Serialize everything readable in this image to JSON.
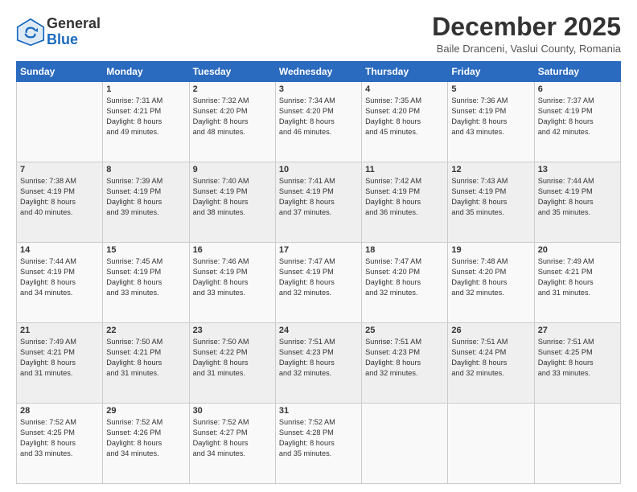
{
  "logo": {
    "general": "General",
    "blue": "Blue"
  },
  "header": {
    "month": "December 2025",
    "location": "Baile Dranceni, Vaslui County, Romania"
  },
  "days": [
    "Sunday",
    "Monday",
    "Tuesday",
    "Wednesday",
    "Thursday",
    "Friday",
    "Saturday"
  ],
  "weeks": [
    [
      {
        "day": "",
        "lines": []
      },
      {
        "day": "1",
        "lines": [
          "Sunrise: 7:31 AM",
          "Sunset: 4:21 PM",
          "Daylight: 8 hours",
          "and 49 minutes."
        ]
      },
      {
        "day": "2",
        "lines": [
          "Sunrise: 7:32 AM",
          "Sunset: 4:20 PM",
          "Daylight: 8 hours",
          "and 48 minutes."
        ]
      },
      {
        "day": "3",
        "lines": [
          "Sunrise: 7:34 AM",
          "Sunset: 4:20 PM",
          "Daylight: 8 hours",
          "and 46 minutes."
        ]
      },
      {
        "day": "4",
        "lines": [
          "Sunrise: 7:35 AM",
          "Sunset: 4:20 PM",
          "Daylight: 8 hours",
          "and 45 minutes."
        ]
      },
      {
        "day": "5",
        "lines": [
          "Sunrise: 7:36 AM",
          "Sunset: 4:19 PM",
          "Daylight: 8 hours",
          "and 43 minutes."
        ]
      },
      {
        "day": "6",
        "lines": [
          "Sunrise: 7:37 AM",
          "Sunset: 4:19 PM",
          "Daylight: 8 hours",
          "and 42 minutes."
        ]
      }
    ],
    [
      {
        "day": "7",
        "lines": [
          "Sunrise: 7:38 AM",
          "Sunset: 4:19 PM",
          "Daylight: 8 hours",
          "and 40 minutes."
        ]
      },
      {
        "day": "8",
        "lines": [
          "Sunrise: 7:39 AM",
          "Sunset: 4:19 PM",
          "Daylight: 8 hours",
          "and 39 minutes."
        ]
      },
      {
        "day": "9",
        "lines": [
          "Sunrise: 7:40 AM",
          "Sunset: 4:19 PM",
          "Daylight: 8 hours",
          "and 38 minutes."
        ]
      },
      {
        "day": "10",
        "lines": [
          "Sunrise: 7:41 AM",
          "Sunset: 4:19 PM",
          "Daylight: 8 hours",
          "and 37 minutes."
        ]
      },
      {
        "day": "11",
        "lines": [
          "Sunrise: 7:42 AM",
          "Sunset: 4:19 PM",
          "Daylight: 8 hours",
          "and 36 minutes."
        ]
      },
      {
        "day": "12",
        "lines": [
          "Sunrise: 7:43 AM",
          "Sunset: 4:19 PM",
          "Daylight: 8 hours",
          "and 35 minutes."
        ]
      },
      {
        "day": "13",
        "lines": [
          "Sunrise: 7:44 AM",
          "Sunset: 4:19 PM",
          "Daylight: 8 hours",
          "and 35 minutes."
        ]
      }
    ],
    [
      {
        "day": "14",
        "lines": [
          "Sunrise: 7:44 AM",
          "Sunset: 4:19 PM",
          "Daylight: 8 hours",
          "and 34 minutes."
        ]
      },
      {
        "day": "15",
        "lines": [
          "Sunrise: 7:45 AM",
          "Sunset: 4:19 PM",
          "Daylight: 8 hours",
          "and 33 minutes."
        ]
      },
      {
        "day": "16",
        "lines": [
          "Sunrise: 7:46 AM",
          "Sunset: 4:19 PM",
          "Daylight: 8 hours",
          "and 33 minutes."
        ]
      },
      {
        "day": "17",
        "lines": [
          "Sunrise: 7:47 AM",
          "Sunset: 4:19 PM",
          "Daylight: 8 hours",
          "and 32 minutes."
        ]
      },
      {
        "day": "18",
        "lines": [
          "Sunrise: 7:47 AM",
          "Sunset: 4:20 PM",
          "Daylight: 8 hours",
          "and 32 minutes."
        ]
      },
      {
        "day": "19",
        "lines": [
          "Sunrise: 7:48 AM",
          "Sunset: 4:20 PM",
          "Daylight: 8 hours",
          "and 32 minutes."
        ]
      },
      {
        "day": "20",
        "lines": [
          "Sunrise: 7:49 AM",
          "Sunset: 4:21 PM",
          "Daylight: 8 hours",
          "and 31 minutes."
        ]
      }
    ],
    [
      {
        "day": "21",
        "lines": [
          "Sunrise: 7:49 AM",
          "Sunset: 4:21 PM",
          "Daylight: 8 hours",
          "and 31 minutes."
        ]
      },
      {
        "day": "22",
        "lines": [
          "Sunrise: 7:50 AM",
          "Sunset: 4:21 PM",
          "Daylight: 8 hours",
          "and 31 minutes."
        ]
      },
      {
        "day": "23",
        "lines": [
          "Sunrise: 7:50 AM",
          "Sunset: 4:22 PM",
          "Daylight: 8 hours",
          "and 31 minutes."
        ]
      },
      {
        "day": "24",
        "lines": [
          "Sunrise: 7:51 AM",
          "Sunset: 4:23 PM",
          "Daylight: 8 hours",
          "and 32 minutes."
        ]
      },
      {
        "day": "25",
        "lines": [
          "Sunrise: 7:51 AM",
          "Sunset: 4:23 PM",
          "Daylight: 8 hours",
          "and 32 minutes."
        ]
      },
      {
        "day": "26",
        "lines": [
          "Sunrise: 7:51 AM",
          "Sunset: 4:24 PM",
          "Daylight: 8 hours",
          "and 32 minutes."
        ]
      },
      {
        "day": "27",
        "lines": [
          "Sunrise: 7:51 AM",
          "Sunset: 4:25 PM",
          "Daylight: 8 hours",
          "and 33 minutes."
        ]
      }
    ],
    [
      {
        "day": "28",
        "lines": [
          "Sunrise: 7:52 AM",
          "Sunset: 4:25 PM",
          "Daylight: 8 hours",
          "and 33 minutes."
        ]
      },
      {
        "day": "29",
        "lines": [
          "Sunrise: 7:52 AM",
          "Sunset: 4:26 PM",
          "Daylight: 8 hours",
          "and 34 minutes."
        ]
      },
      {
        "day": "30",
        "lines": [
          "Sunrise: 7:52 AM",
          "Sunset: 4:27 PM",
          "Daylight: 8 hours",
          "and 34 minutes."
        ]
      },
      {
        "day": "31",
        "lines": [
          "Sunrise: 7:52 AM",
          "Sunset: 4:28 PM",
          "Daylight: 8 hours",
          "and 35 minutes."
        ]
      },
      {
        "day": "",
        "lines": []
      },
      {
        "day": "",
        "lines": []
      },
      {
        "day": "",
        "lines": []
      }
    ]
  ]
}
